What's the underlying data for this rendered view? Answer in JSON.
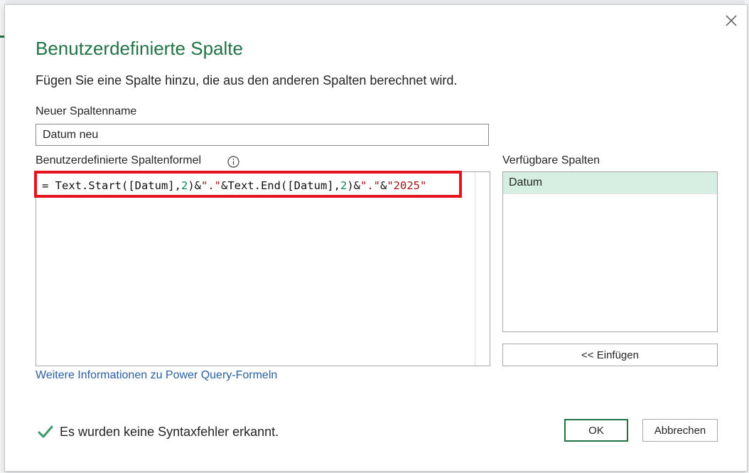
{
  "dialog": {
    "title": "Benutzerdefinierte Spalte",
    "subtitle": "Fügen Sie eine Spalte hinzu, die aus den anderen Spalten berechnet wird."
  },
  "column_name": {
    "label": "Neuer Spaltenname",
    "value": "Datum neu"
  },
  "formula": {
    "label": "Benutzerdefinierte Spaltenformel",
    "tokens": {
      "t1": "= Text.Start([Datum],",
      "t2": "2",
      "t3": ")&",
      "t4": "\".\"",
      "t5": "&Text.End([Datum],",
      "t6": "2",
      "t7": ")&",
      "t8": "\".\"",
      "t9": "&",
      "t10": "\"2025\""
    }
  },
  "available_columns": {
    "label": "Verfügbare Spalten",
    "items": [
      "Datum"
    ],
    "insert_label": "<< Einfügen"
  },
  "help_link": "Weitere Informationen zu Power Query-Formeln",
  "status": {
    "text": "Es wurden keine Syntaxfehler erkannt.",
    "icon": "checkmark-icon"
  },
  "buttons": {
    "ok": "OK",
    "cancel": "Abbrechen"
  },
  "colors": {
    "accent": "#217346",
    "highlight": "#e3141f",
    "link": "#2a5f9e",
    "selected_item": "#d6efe2"
  }
}
